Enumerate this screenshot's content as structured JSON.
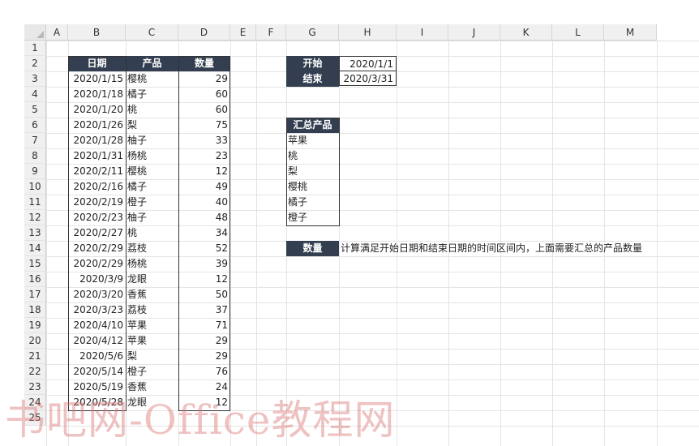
{
  "columns": [
    "A",
    "B",
    "C",
    "D",
    "E",
    "F",
    "G",
    "H",
    "I",
    "J",
    "K",
    "L",
    "M"
  ],
  "rows": [
    "1",
    "2",
    "3",
    "4",
    "5",
    "6",
    "7",
    "8",
    "9",
    "10",
    "11",
    "12",
    "13",
    "14",
    "15",
    "16",
    "17",
    "18",
    "19",
    "20",
    "21",
    "22",
    "23",
    "24",
    "25"
  ],
  "table": {
    "headers": [
      "日期",
      "产品",
      "数量"
    ],
    "rows": [
      {
        "date": "2020/1/15",
        "product": "樱桃",
        "qty": "29"
      },
      {
        "date": "2020/1/18",
        "product": "橘子",
        "qty": "60"
      },
      {
        "date": "2020/1/20",
        "product": "桃",
        "qty": "60"
      },
      {
        "date": "2020/1/26",
        "product": "梨",
        "qty": "75"
      },
      {
        "date": "2020/1/28",
        "product": "柚子",
        "qty": "33"
      },
      {
        "date": "2020/1/31",
        "product": "杨桃",
        "qty": "23"
      },
      {
        "date": "2020/2/11",
        "product": "樱桃",
        "qty": "12"
      },
      {
        "date": "2020/2/16",
        "product": "橘子",
        "qty": "49"
      },
      {
        "date": "2020/2/19",
        "product": "橙子",
        "qty": "40"
      },
      {
        "date": "2020/2/23",
        "product": "柚子",
        "qty": "48"
      },
      {
        "date": "2020/2/27",
        "product": "桃",
        "qty": "34"
      },
      {
        "date": "2020/2/29",
        "product": "荔枝",
        "qty": "52"
      },
      {
        "date": "2020/2/29",
        "product": "杨桃",
        "qty": "39"
      },
      {
        "date": "2020/3/9",
        "product": "龙眼",
        "qty": "12"
      },
      {
        "date": "2020/3/20",
        "product": "香蕉",
        "qty": "50"
      },
      {
        "date": "2020/3/23",
        "product": "荔枝",
        "qty": "37"
      },
      {
        "date": "2020/4/10",
        "product": "苹果",
        "qty": "71"
      },
      {
        "date": "2020/4/12",
        "product": "苹果",
        "qty": "29"
      },
      {
        "date": "2020/5/6",
        "product": "梨",
        "qty": "29"
      },
      {
        "date": "2020/5/14",
        "product": "橙子",
        "qty": "76"
      },
      {
        "date": "2020/5/19",
        "product": "香蕉",
        "qty": "24"
      },
      {
        "date": "2020/5/28",
        "product": "龙眼",
        "qty": "12"
      }
    ]
  },
  "range": {
    "start_label": "开始",
    "start_value": "2020/1/1",
    "end_label": "结束",
    "end_value": "2020/3/31"
  },
  "summary": {
    "header": "汇总产品",
    "items": [
      "苹果",
      "桃",
      "梨",
      "樱桃",
      "橘子",
      "橙子"
    ]
  },
  "quantity": {
    "label": "数量",
    "note": "计算满足开始日期和结束日期的时间区间内，上面需要汇总的产品数量"
  },
  "watermark": "书吧网-Office教程网",
  "colors": {
    "header_bg": "#333f50",
    "header_text": "#ffffff"
  }
}
